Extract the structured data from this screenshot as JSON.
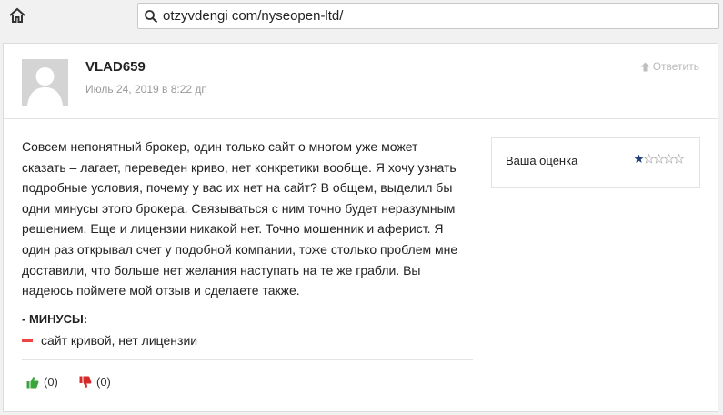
{
  "browser": {
    "url": "otzyvdengi com/nyseopen-ltd/"
  },
  "review": {
    "author": "VLAD659",
    "date": "Июль 24, 2019 в 8:22 дп",
    "reply_label": "Ответить",
    "text": "Совсем непонятный брокер, один только сайт о многом уже может сказать – лагает, переведен криво, нет конкретики вообще. Я хочу узнать подробные условия, почему у вас их нет на сайт? В общем, выделил бы одни минусы этого брокера. Связываться с ним точно будет неразумным решением. Еще и лицензии никакой нет. Точно мошенник и аферист. Я один раз открывал счет у подобной компании, тоже столько проблем мне доставили, что больше нет желания наступать на те же грабли. Вы надеюсь поймете мой отзыв и сделаете также.",
    "rating_label": "Ваша оценка",
    "rating_value": 1,
    "rating_max": 5,
    "cons_title": "- МИНУСЫ:",
    "cons_items": [
      "сайт кривой, нет лицензии"
    ],
    "likes": "(0)",
    "dislikes": "(0)"
  },
  "colors": {
    "star_filled": "#1e3f7a",
    "like": "#3aa53a",
    "dislike": "#d62b2b",
    "cons_dash": "#e44444"
  }
}
